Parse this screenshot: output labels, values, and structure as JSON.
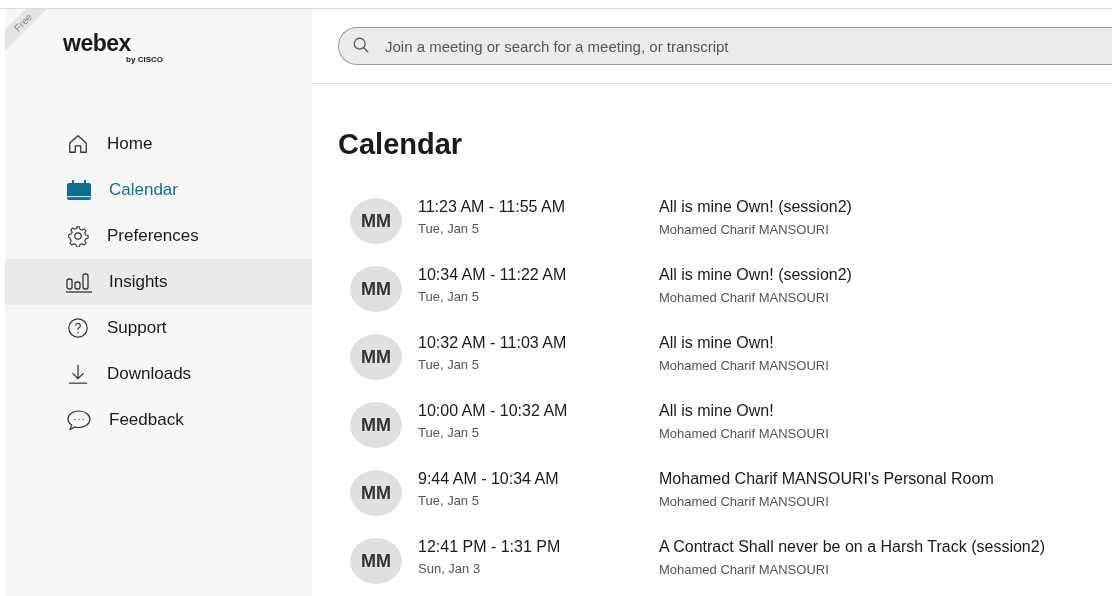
{
  "plan_badge": "Free",
  "logo": {
    "name": "webex",
    "tagline": "by CISCO"
  },
  "nav": [
    {
      "label": "Home",
      "kind": "home",
      "selected": false,
      "hovered": false
    },
    {
      "label": "Calendar",
      "kind": "calendar",
      "selected": true,
      "hovered": false
    },
    {
      "label": "Preferences",
      "kind": "gear",
      "selected": false,
      "hovered": false
    },
    {
      "label": "Insights",
      "kind": "insights",
      "selected": false,
      "hovered": true
    },
    {
      "label": "Support",
      "kind": "help",
      "selected": false,
      "hovered": false
    },
    {
      "label": "Downloads",
      "kind": "download",
      "selected": false,
      "hovered": false
    },
    {
      "label": "Feedback",
      "kind": "chat",
      "selected": false,
      "hovered": false
    }
  ],
  "search": {
    "placeholder": "Join a meeting or search for a meeting, or transcript"
  },
  "page_title": "Calendar",
  "meetings": [
    {
      "initials": "MM",
      "time": "11:23 AM - 11:55 AM",
      "date": "Tue, Jan 5",
      "title": "All is mine Own! (session2)",
      "host": "Mohamed Charif MANSOURI"
    },
    {
      "initials": "MM",
      "time": "10:34 AM - 11:22 AM",
      "date": "Tue, Jan 5",
      "title": "All is mine Own! (session2)",
      "host": "Mohamed Charif MANSOURI"
    },
    {
      "initials": "MM",
      "time": "10:32 AM - 11:03 AM",
      "date": "Tue, Jan 5",
      "title": "All is mine Own!",
      "host": "Mohamed Charif MANSOURI"
    },
    {
      "initials": "MM",
      "time": "10:00 AM - 10:32 AM",
      "date": "Tue, Jan 5",
      "title": "All is mine Own!",
      "host": "Mohamed Charif MANSOURI"
    },
    {
      "initials": "MM",
      "time": "9:44 AM - 10:34 AM",
      "date": "Tue, Jan 5",
      "title": "Mohamed Charif MANSOURI's Personal Room",
      "host": "Mohamed Charif MANSOURI"
    },
    {
      "initials": "MM",
      "time": "12:41 PM - 1:31 PM",
      "date": "Sun, Jan 3",
      "title": "A Contract Shall never be on a Harsh Track (session2)",
      "host": "Mohamed Charif MANSOURI"
    }
  ]
}
